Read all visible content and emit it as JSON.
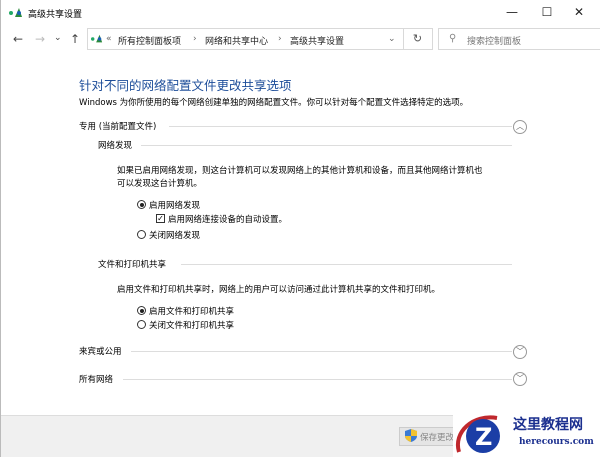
{
  "window": {
    "title": "高级共享设置",
    "minimize": "—",
    "maximize": "☐",
    "close": "✕"
  },
  "nav": {
    "back": "←",
    "forward": "→",
    "recent": "⌄",
    "up": "↑",
    "breadcrumbs": [
      "所有控制面板项",
      "网络和共享中心",
      "高级共享设置"
    ],
    "overflow": "«",
    "sep": "›",
    "dropdown": "⌄",
    "refresh": "↻"
  },
  "search": {
    "placeholder": "搜索控制面板"
  },
  "main": {
    "heading": "针对不同的网络配置文件更改共享选项",
    "description": "Windows 为你所使用的每个网络创建单独的网络配置文件。你可以针对每个配置文件选择特定的选项。",
    "profile_private": "专用 (当前配置文件)",
    "discovery": {
      "title": "网络发现",
      "text1": "如果已启用网络发现，则这台计算机可以发现网络上的其他计算机和设备，而且其他网络计算机也",
      "text2": "可以发现这台计算机。",
      "on": "启用网络发现",
      "auto": "启用网络连接设备的自动设置。",
      "off": "关闭网络发现",
      "selected": "on",
      "auto_checked": true
    },
    "sharing": {
      "title": "文件和打印机共享",
      "text": "启用文件和打印机共享时，网络上的用户可以访问通过此计算机共享的文件和打印机。",
      "on": "启用文件和打印机共享",
      "off": "关闭文件和打印机共享",
      "selected": "on"
    },
    "profile_guest": "来宾或公用",
    "profile_all": "所有网络"
  },
  "footer": {
    "save": "保存更改"
  },
  "watermark": {
    "cn": "这里教程网",
    "en": "herecours.com"
  }
}
